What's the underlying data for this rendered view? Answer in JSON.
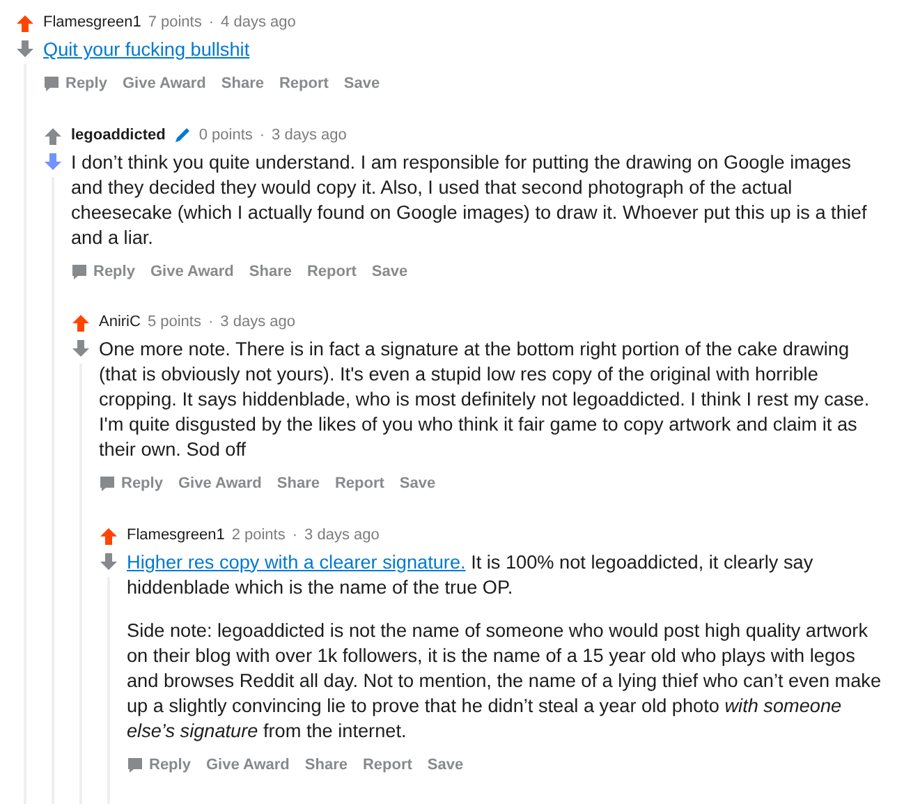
{
  "comments": [
    {
      "author": "Flamesgreen1",
      "submitter": false,
      "points": "7 points",
      "separator": "·",
      "time": "4 days ago",
      "upvoted": true,
      "downvoted": false,
      "body": [
        {
          "link": "Quit your fucking bullshit"
        }
      ],
      "actions": [
        "Reply",
        "Give Award",
        "Share",
        "Report",
        "Save"
      ],
      "children": [
        {
          "author": "legoaddicted",
          "submitter": true,
          "points": "0 points",
          "separator": "·",
          "time": "3 days ago",
          "upvoted": false,
          "downvoted": true,
          "body": [
            {
              "text": "I don’t think you quite understand. I am responsible for putting the drawing on Google images and they decided they would copy it. Also, I used that second photograph of the actual cheesecake (which I actually found on Google images) to draw it. Whoever put this up is a thief and a liar."
            }
          ],
          "actions": [
            "Reply",
            "Give Award",
            "Share",
            "Report",
            "Save"
          ],
          "children": [
            {
              "author": "AniriC",
              "submitter": false,
              "points": "5 points",
              "separator": "·",
              "time": "3 days ago",
              "upvoted": true,
              "downvoted": false,
              "body": [
                {
                  "text": "One more note. There is in fact a signature at the bottom right portion of the cake drawing (that is obviously not yours). It's even a stupid low res copy of the original with horrible cropping. It says hiddenblade, who is most definitely not legoaddicted. I think I rest my case. I'm quite disgusted by the likes of you who think it fair game to copy artwork and claim it as their own. Sod off"
                }
              ],
              "actions": [
                "Reply",
                "Give Award",
                "Share",
                "Report",
                "Save"
              ],
              "children": [
                {
                  "author": "Flamesgreen1",
                  "submitter": false,
                  "points": "2 points",
                  "separator": "·",
                  "time": "3 days ago",
                  "upvoted": true,
                  "downvoted": false,
                  "body": [
                    {
                      "link": "Higher res copy with a clearer signature.",
                      "text": "It is 100% not legoaddicted, it clearly say hiddenblade which is the name of the true OP."
                    },
                    {
                      "text": "Side note: legoaddicted is not the name of someone who would post high quality artwork on their blog with over 1k followers, it is the name of a 15 year old who plays with legos and browses Reddit all day. Not to mention, the name of a lying thief who can’t even make up a slightly convincing lie to prove that he didn’t steal a year old photo *with someone else’s signature* from the internet."
                    }
                  ],
                  "actions": [
                    "Reply",
                    "Give Award",
                    "Share",
                    "Report",
                    "Save"
                  ]
                }
              ]
            }
          ]
        }
      ]
    }
  ]
}
